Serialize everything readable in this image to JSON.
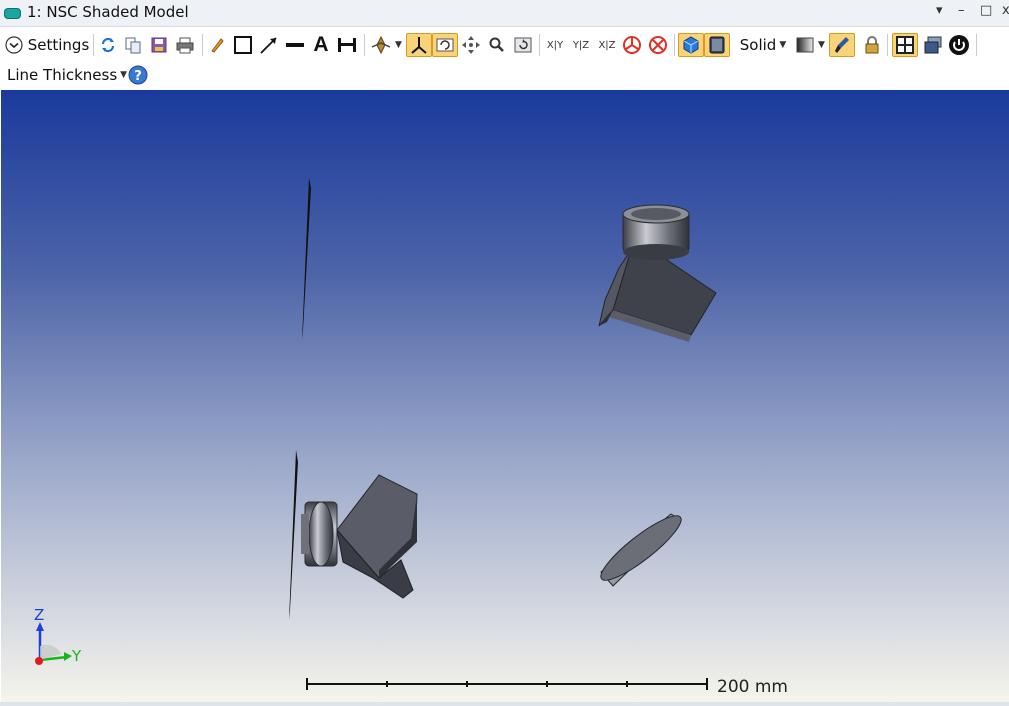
{
  "window": {
    "title": "1: NSC Shaded Model",
    "controls": {
      "menu": "▾",
      "minimize": "–",
      "maximize": "□",
      "close": "x"
    }
  },
  "toolbar": {
    "settings_label": "Settings",
    "solid_label": "Solid",
    "axis_xy": "X|Y",
    "axis_yz": "Y|Z",
    "axis_xz": "X|Z",
    "line_thickness_label": "Line Thickness",
    "help_glyph": "?",
    "text_tool_glyph": "A"
  },
  "viewport": {
    "scale_bar_label": "200 mm",
    "axis_labels": {
      "z": "Z",
      "y": "Y"
    }
  },
  "icons": [
    "settings-chevron-icon",
    "refresh-icon",
    "copy-icon",
    "save-icon",
    "print-icon",
    "pencil-icon",
    "rectangle-icon",
    "arrow-icon",
    "line-icon",
    "text-icon",
    "dimension-icon",
    "rotate-view-icon",
    "axes-icon",
    "rotate-icon",
    "pan-icon",
    "zoom-icon",
    "reset-view-icon",
    "no-ray-icon",
    "solid-cube-icon",
    "gradient-icon",
    "brush-icon",
    "lock-icon",
    "layout-icon",
    "window-icon",
    "power-icon",
    "help-icon"
  ],
  "colors": {
    "accent_active": "#f9d37a",
    "viewport_top": "#1a3a9c",
    "viewport_bottom": "#f5f4ec",
    "z_axis": "#1f3fd6",
    "y_axis": "#19b619",
    "x_axis": "#e01b1b"
  }
}
